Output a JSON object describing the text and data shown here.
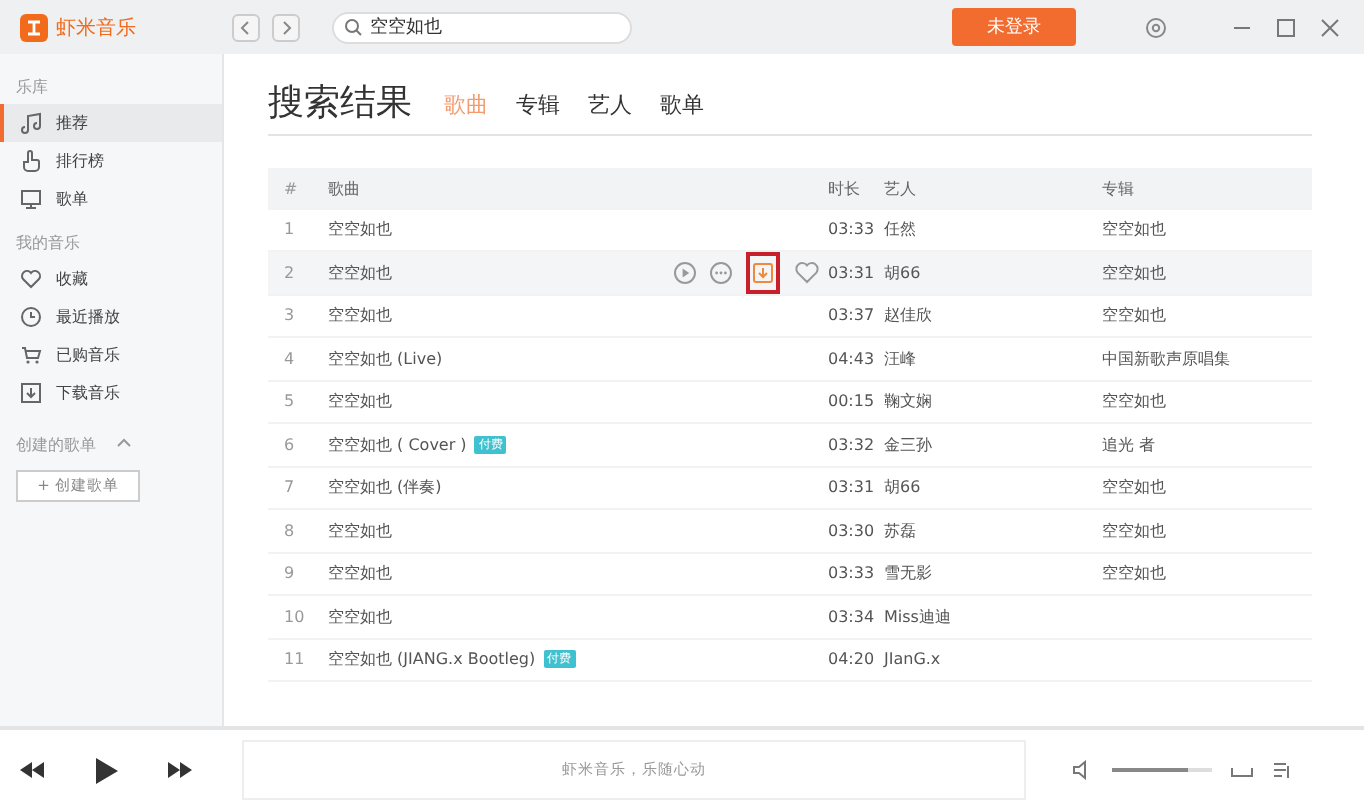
{
  "app": {
    "name": "虾米音乐",
    "search_value": "空空如也",
    "login_button": "未登录"
  },
  "sidebar": {
    "sections": [
      {
        "title": "乐库",
        "items": [
          {
            "label": "推荐",
            "selected": true
          },
          {
            "label": "排行榜",
            "selected": false
          },
          {
            "label": "歌单",
            "selected": false
          }
        ]
      },
      {
        "title": "我的音乐",
        "items": [
          {
            "label": "收藏",
            "selected": false
          },
          {
            "label": "最近播放",
            "selected": false
          },
          {
            "label": "已购音乐",
            "selected": false
          },
          {
            "label": "下载音乐",
            "selected": false
          }
        ]
      }
    ],
    "playlists_title": "创建的歌单",
    "playlists_expanded": true,
    "create_button": "+ 创建歌单"
  },
  "page_title": "搜索结果",
  "tabs": [
    {
      "label": "歌曲",
      "selected": true
    },
    {
      "label": "专辑",
      "selected": false
    },
    {
      "label": "艺人",
      "selected": false
    },
    {
      "label": "歌单",
      "selected": false
    }
  ],
  "table": {
    "columns": [
      "#",
      "歌曲",
      "时长",
      "艺人",
      "专辑"
    ],
    "rows": [
      {
        "num": "1",
        "song": "空空如也",
        "duration": "03:33",
        "artist": "任然",
        "album": "空空如也",
        "hovered": false
      },
      {
        "num": "2",
        "song": "空空如也",
        "duration": "03:31",
        "artist": "胡66",
        "album": "空空如也",
        "hovered": true
      },
      {
        "num": "3",
        "song": "空空如也",
        "duration": "03:37",
        "artist": "赵佳欣",
        "album": "空空如也",
        "hovered": false
      },
      {
        "num": "4",
        "song": "空空如也 (Live)",
        "duration": "04:43",
        "artist": "汪峰",
        "album": "中国新歌声原唱集",
        "hovered": false
      },
      {
        "num": "5",
        "song": "空空如也",
        "duration": "00:15",
        "artist": "鞠文娴",
        "album": "空空如也",
        "hovered": false
      },
      {
        "num": "6",
        "song": "空空如也 ( Cover )",
        "badge": "付费",
        "duration": "03:32",
        "artist": "金三孙",
        "album": "追光 者",
        "hovered": false
      },
      {
        "num": "7",
        "song": "空空如也 (伴奏)",
        "duration": "03:31",
        "artist": "胡66",
        "album": "空空如也",
        "hovered": false
      },
      {
        "num": "8",
        "song": "空空如也",
        "duration": "03:30",
        "artist": "苏磊",
        "album": "空空如也",
        "hovered": false
      },
      {
        "num": "9",
        "song": "空空如也",
        "duration": "03:33",
        "artist": "雪无影",
        "album": "空空如也",
        "hovered": false
      },
      {
        "num": "10",
        "song": "空空如也",
        "duration": "03:34",
        "artist": "Miss迪迪",
        "hovered": false
      },
      {
        "num": "11",
        "song": "空空如也 (JIANG.x Bootleg)",
        "badge": "付费",
        "duration": "04:20",
        "artist": "JIanG.x",
        "hovered": false
      }
    ]
  },
  "player": {
    "now_playing": "虾米音乐，乐随心动",
    "volume": {
      "level": 0.75
    }
  }
}
